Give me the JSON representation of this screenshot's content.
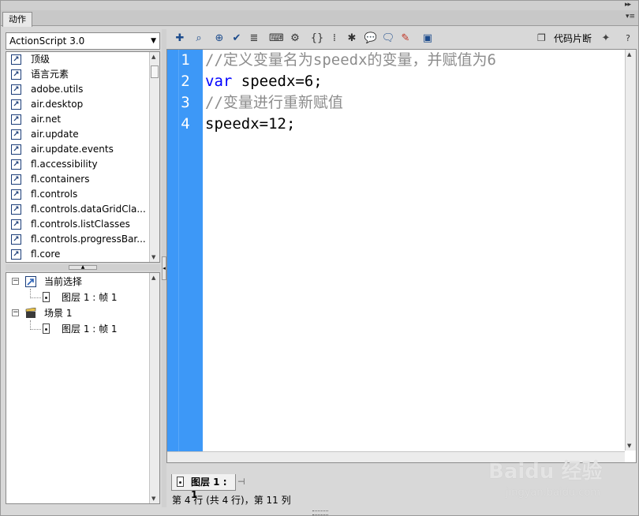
{
  "panel": {
    "tab_label": "动作",
    "collapse_icon": "double-chevron-right-icon",
    "menu_icon": "panel-menu-icon"
  },
  "language_select": {
    "value": "ActionScript 3.0"
  },
  "library": {
    "items": [
      {
        "label": "顶级"
      },
      {
        "label": "语言元素"
      },
      {
        "label": "adobe.utils"
      },
      {
        "label": "air.desktop"
      },
      {
        "label": "air.net"
      },
      {
        "label": "air.update"
      },
      {
        "label": "air.update.events"
      },
      {
        "label": "fl.accessibility"
      },
      {
        "label": "fl.containers"
      },
      {
        "label": "fl.controls"
      },
      {
        "label": "fl.controls.dataGridCla..."
      },
      {
        "label": "fl.controls.listClasses"
      },
      {
        "label": "fl.controls.progressBar..."
      },
      {
        "label": "fl.core"
      }
    ]
  },
  "tree": {
    "current_selection": "当前选择",
    "current_frame": "图层 1 : 帧 1",
    "scene": "场景 1",
    "scene_frame": "图层 1 : 帧 1"
  },
  "toolbar": {
    "snippets_label": "代码片断",
    "help": "?"
  },
  "editor": {
    "lines": [
      {
        "no": "1",
        "text": "//定义变量名为speedx的变量，并赋值为6"
      },
      {
        "no": "2",
        "kw": "var",
        "text": " speedx=6;"
      },
      {
        "no": "3",
        "text": "//变量进行重新赋值"
      },
      {
        "no": "4",
        "text": "speedx=12;"
      }
    ]
  },
  "layer_tab": {
    "label": "图层 1 : 1"
  },
  "status": {
    "text": "第 4 行 (共 4 行)，第 11 列"
  },
  "watermark": {
    "brand": "Baidu 经验",
    "url": "jingyan.baidu.com"
  },
  "colors": {
    "gutter": "#3d98f7",
    "comment": "#8d8d8d",
    "keyword": "#0000ff"
  }
}
